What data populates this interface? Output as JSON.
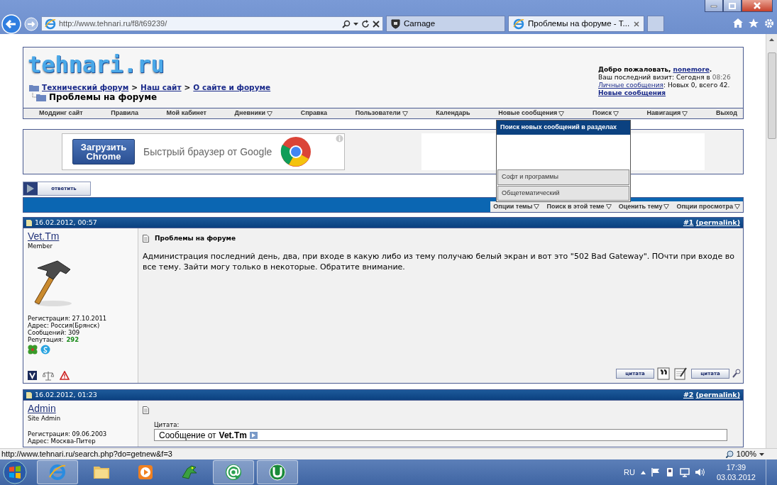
{
  "browser": {
    "address": "http://www.tehnari.ru/f8/t69239/",
    "tabs": [
      {
        "label": "Carnage",
        "selected": false
      },
      {
        "label": "Проблемы на форуме - Т...",
        "selected": true
      }
    ]
  },
  "header": {
    "logo": "tehnari.ru",
    "breadcrumb": [
      {
        "kind": "link",
        "label": "Технический форум"
      },
      {
        "kind": "sep",
        "label": ">"
      },
      {
        "kind": "link",
        "label": "Наш сайт"
      },
      {
        "kind": "sep",
        "label": ">"
      },
      {
        "kind": "link",
        "label": "О сайте и форуме"
      }
    ],
    "page_title": "Проблемы на форуме",
    "user_panel": {
      "greeting": "Добро пожаловать,",
      "username": "nonemore",
      "greeting_end": ".",
      "last_visit": "Ваш последний визит: Сегодня в",
      "last_visit_time": "08:26",
      "messages_link": "Личные сообщения",
      "messages_text": ": Новых 0, всего 42.",
      "new_posts_link": "Новые сообщения"
    }
  },
  "navbar": [
    {
      "label": "Моддинг сайт",
      "dropdown": false
    },
    {
      "label": "Правила",
      "dropdown": false
    },
    {
      "label": "Мой кабинет",
      "dropdown": false
    },
    {
      "label": "Дневники",
      "dropdown": true
    },
    {
      "label": "Справка",
      "dropdown": false
    },
    {
      "label": "Пользователи",
      "dropdown": true
    },
    {
      "label": "Календарь",
      "dropdown": false
    },
    {
      "label": "Новые сообщения",
      "dropdown": true
    },
    {
      "label": "Поиск",
      "dropdown": true
    },
    {
      "label": "Навигация",
      "dropdown": true
    },
    {
      "label": "Выход",
      "dropdown": false
    }
  ],
  "ad": {
    "button": "Загрузить Chrome",
    "tagline": "Быстрый браузер от Google"
  },
  "dropdown_menu": [
    {
      "label": "Поиск новых сообщений в разделах",
      "selected": true
    },
    {
      "label": "Софт и программы",
      "selected": false
    },
    {
      "label": "Общетематический",
      "selected": false
    }
  ],
  "reply_button": "ответить",
  "thread_tools": [
    {
      "label": "Опции темы",
      "dropdown": true
    },
    {
      "label": "Поиск в этой теме",
      "dropdown": true
    },
    {
      "label": "Оценить тему",
      "dropdown": true
    },
    {
      "label": "Опции просмотра",
      "dropdown": true
    }
  ],
  "posts": [
    {
      "date": "16.02.2012, 00:57",
      "number": "#1",
      "permalink": "(permalink)",
      "username": "Vet.Tm",
      "rank": "Member",
      "avatar": true,
      "details": [
        "Регистрация: 27.10.2011",
        "Адрес: Россия(Брянск)",
        "Сообщений: 309"
      ],
      "reputation_label": "Репутация:",
      "reputation": "292",
      "title": "Проблемы на форуме",
      "message": "Администрация последний день, два, при входе в какую либо из тему получаю белый экран и вот это \"502 Bad Gateway\". ПОчти при входе во все тему. Зайти могу только в некоторые. Обратите внимание.",
      "quote_buttons": [
        "цитата",
        "цитата"
      ]
    },
    {
      "date": "16.02.2012, 01:23",
      "number": "#2",
      "permalink": "(permalink)",
      "username": "Admin",
      "rank": "Site Admin",
      "details": [
        "Регистрация: 09.06.2003",
        "Адрес: Москва-Питер"
      ],
      "quote": {
        "label": "Цитата:",
        "from": "Сообщение от",
        "author": "Vet.Tm"
      }
    }
  ],
  "status_bar": {
    "url": "http://www.tehnari.ru/search.php?do=getnew&f=3",
    "zoom": "100%"
  },
  "taskbar": {
    "language": "RU",
    "time": "17:39",
    "date": "03.03.2012"
  }
}
